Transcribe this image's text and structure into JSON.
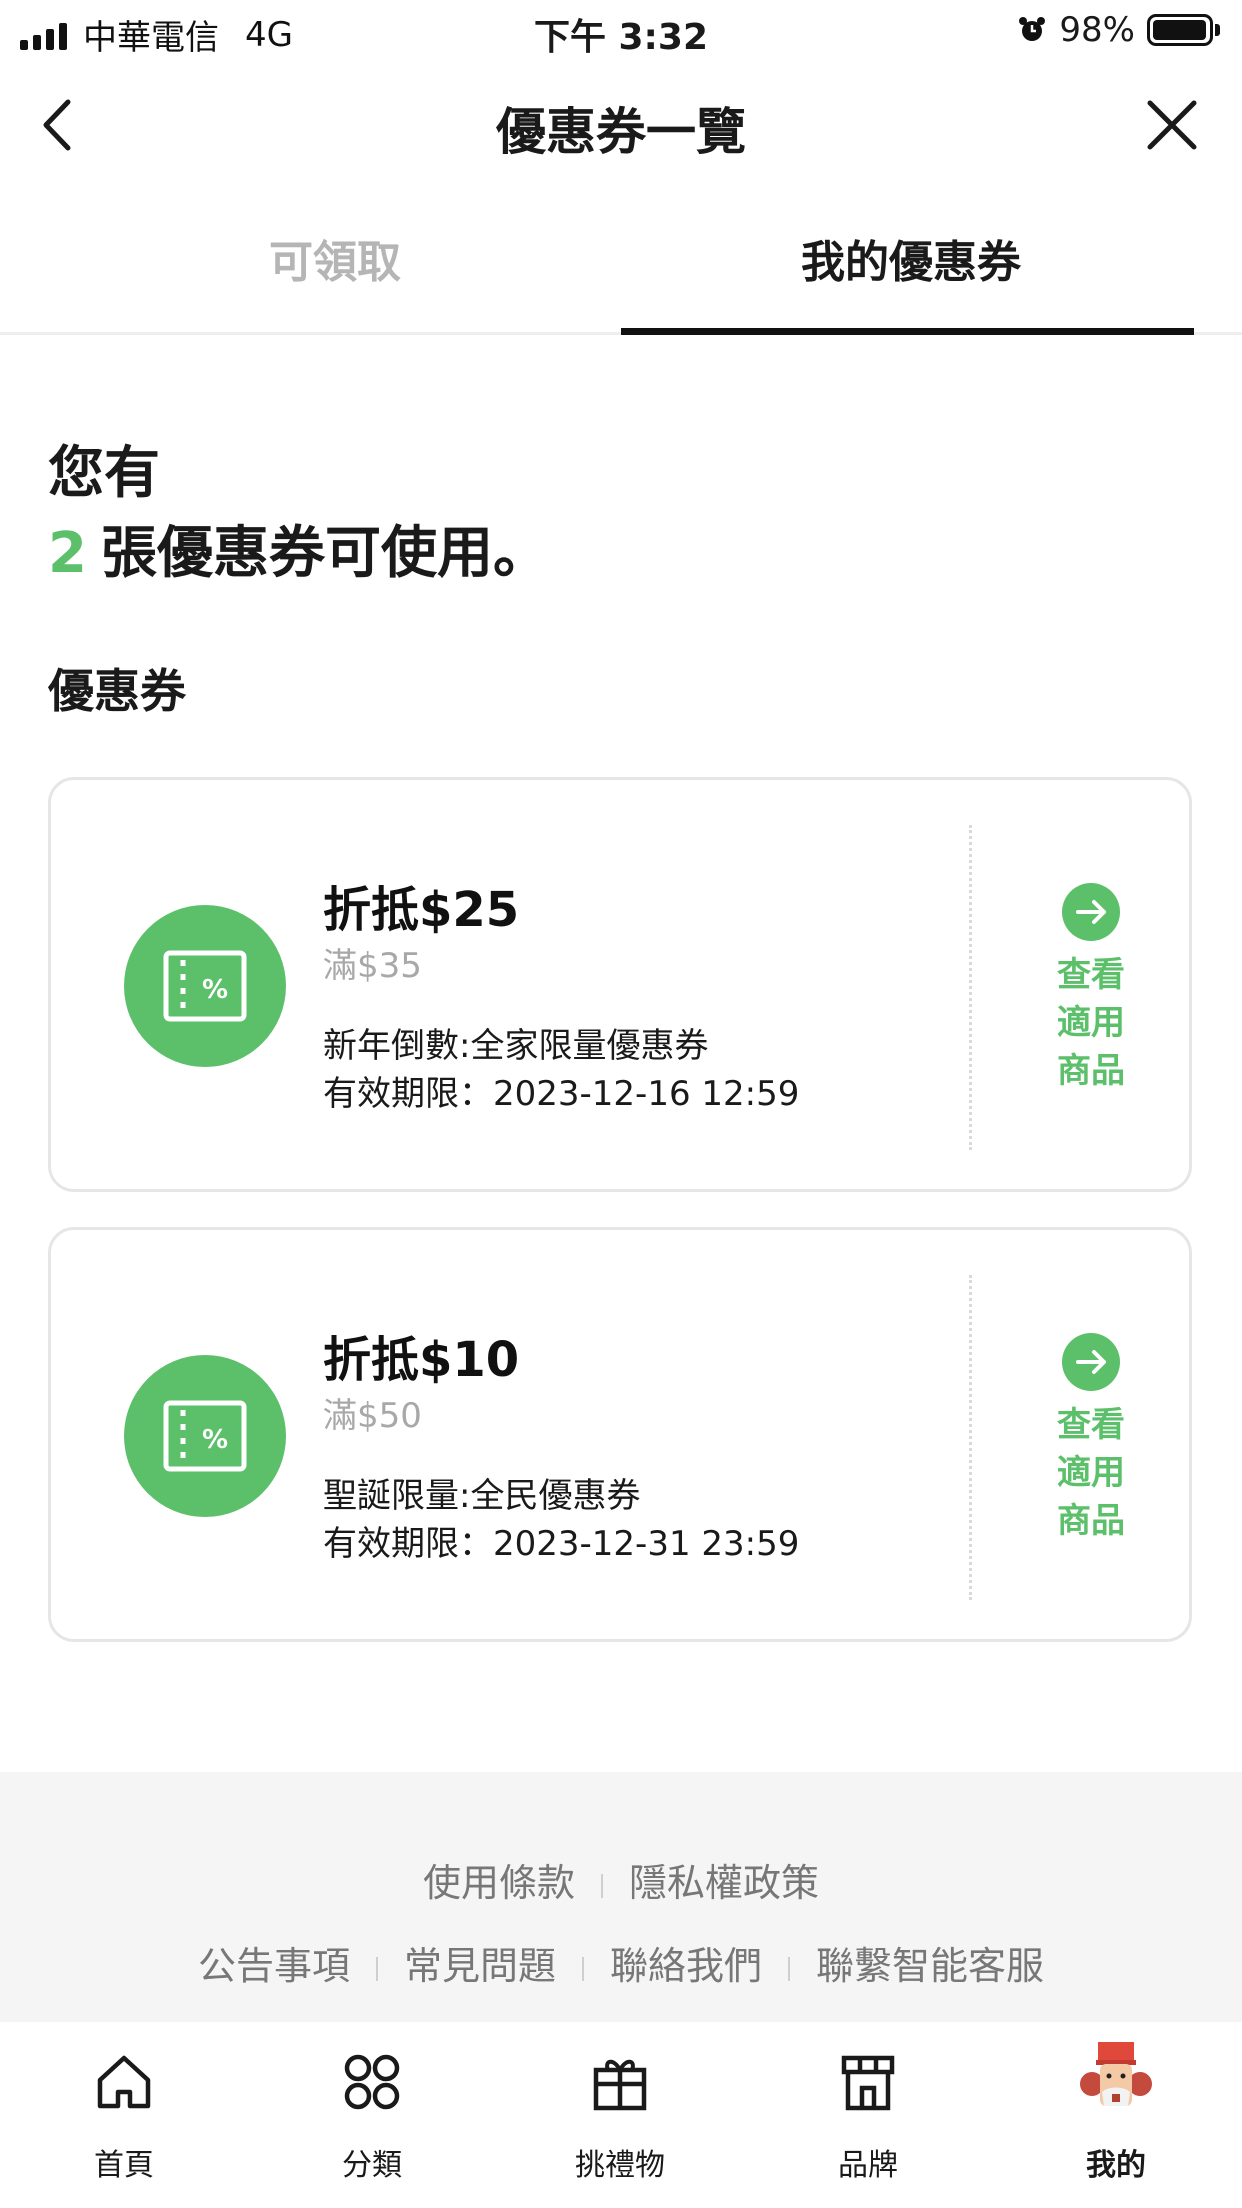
{
  "status_bar": {
    "carrier": "中華電信",
    "network": "4G",
    "time": "下午 3:32",
    "battery_percent": "98%",
    "battery_level": 0.98,
    "icons": [
      "signal-icon",
      "alarm-icon",
      "battery-icon"
    ]
  },
  "header": {
    "title": "優惠券一覽",
    "back_icon": "chevron-left-icon",
    "close_icon": "close-icon"
  },
  "tabs": [
    {
      "label": "可領取",
      "active": false
    },
    {
      "label": "我的優惠券",
      "active": true
    }
  ],
  "summary": {
    "line1": "您有",
    "count": "2",
    "line2_suffix": "張優惠券可使用。"
  },
  "section_title": "優惠券",
  "coupons": [
    {
      "amount": "折抵$25",
      "min_spend": "滿$35",
      "name": "新年倒數:全家限量優惠券",
      "expiry": "有效期限：2023-12-16 12:59",
      "link_lines": [
        "查看",
        "適用",
        "商品"
      ],
      "icon": "coupon-percent-icon"
    },
    {
      "amount": "折抵$10",
      "min_spend": "滿$50",
      "name": "聖誕限量:全民優惠券",
      "expiry": "有效期限：2023-12-31 23:59",
      "link_lines": [
        "查看",
        "適用",
        "商品"
      ],
      "icon": "coupon-percent-icon"
    }
  ],
  "footer": {
    "row1": [
      "使用條款",
      "隱私權政策"
    ],
    "row2": [
      "公告事項",
      "常見問題",
      "聯絡我們",
      "聯繫智能客服"
    ]
  },
  "bottom_nav": [
    {
      "label": "首頁",
      "icon": "home-icon",
      "active": false
    },
    {
      "label": "分類",
      "icon": "category-icon",
      "active": false
    },
    {
      "label": "挑禮物",
      "icon": "gift-icon",
      "active": false
    },
    {
      "label": "品牌",
      "icon": "store-icon",
      "active": false
    },
    {
      "label": "我的",
      "icon": "nutcracker-avatar-icon",
      "active": true
    }
  ],
  "colors": {
    "accent_green": "#5cc06b",
    "inactive_tab": "#b5b5b5",
    "muted_text": "#a8a8a8"
  }
}
